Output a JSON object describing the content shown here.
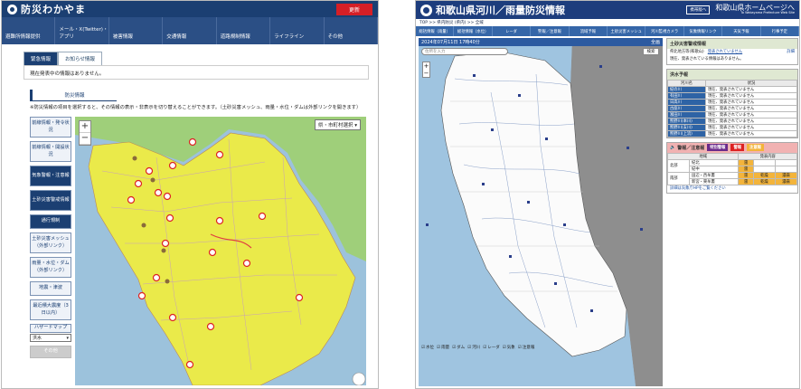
{
  "left": {
    "header": {
      "title": "防災わかやま",
      "red_button": "更新"
    },
    "nav": [
      "避難所情報提供",
      "メール・X(Twitter)・アプリ",
      "被害情報",
      "交通情報",
      "道路規制情報",
      "ライフライン",
      "その他"
    ],
    "tabs": [
      "緊急情報",
      "お知らせ情報"
    ],
    "notice": "現在発表中の情報はありません。",
    "section_title": "防災情報",
    "explanation": "※防災情報の項目を選択すると、その情報の表示・非表示を切り替えることができます。（土砂災害メッシュ、雨量・水位・ダムは外部リンクを開きます）",
    "side_buttons": [
      {
        "label": "前線情報・発令状況",
        "dark": false
      },
      {
        "label": "前線情報・開設状況",
        "dark": false
      },
      {
        "label": "気象警報・注意報",
        "dark": true
      },
      {
        "label": "土砂災害警戒情報",
        "dark": true
      },
      {
        "label": "通行規制",
        "dark": true
      },
      {
        "label": "土砂災害メッシュ（外部リンク）",
        "dark": false
      },
      {
        "label": "雨量・水位・ダム（外部リンク）",
        "dark": false
      },
      {
        "label": "地震・津波",
        "dark": false
      },
      {
        "label": "最近積大震度（3日以内）",
        "dark": false
      }
    ],
    "hazard_label": "ハザードマップ",
    "hazard_select": "洪水",
    "other_button": "その他",
    "map_select": "県・市町村選択",
    "colors": {
      "navy": "#1b3f72",
      "hazard_yellow": "#eaea4a",
      "land_green": "#9fcf7a",
      "sea": "#9cc2dc"
    }
  },
  "right": {
    "header": {
      "title": "和歌山県河川／雨量防災情報",
      "mobile_button": "携帯版へ",
      "home_link": "和歌山県ホームページへ",
      "home_sub": "To Wakayama Prefecture Web Site"
    },
    "breadcrumb": "TOP >> 県内防災 (県内) >> 全域",
    "nav": [
      "総括情報（雨量）",
      "総括情報（水位）",
      "レーダ",
      "警報／注意報",
      "流域予報",
      "土砂災害メッシュ",
      "河川監視カメラ",
      "気象情報リンク",
      "天気予報",
      "行事予定"
    ],
    "map_bar": {
      "time": "2024年07月11日 17時40分",
      "mode": "全画"
    },
    "search": {
      "placeholder": "住所を入力",
      "button": "検索"
    },
    "legend": [
      "水位",
      "雨量",
      "ダム",
      "河川",
      "レーダ",
      "気象",
      "注意報"
    ],
    "panel": {
      "disaster": {
        "title": "土砂災害警戒情報",
        "row_label": "県北地方等(和歌山)",
        "row_status": "発表されていません",
        "row_link": "詳細",
        "note": "現在、発表されている情報はありません。"
      },
      "flood": {
        "title": "洪水予報",
        "headers": [
          "河川名",
          "状況"
        ],
        "rows": [
          [
            "紀の川",
            "現在、発表されていません"
          ],
          [
            "有田川",
            "現在、発表されていません"
          ],
          [
            "日高川",
            "現在、発表されていません"
          ],
          [
            "古座川",
            "現在、発表されていません"
          ],
          [
            "富田川",
            "現在、発表されていません"
          ],
          [
            "熊野川(本川)",
            "現在、発表されていません"
          ],
          [
            "熊野川(支川)",
            "現在、発表されていません"
          ],
          [
            "熊野川(上流)",
            "現在、発表されていません"
          ]
        ]
      },
      "warning": {
        "title": "警報／注意報",
        "badges": [
          "特別警報",
          "警報",
          "注意報"
        ],
        "headers": [
          "地域",
          "発表内容"
        ],
        "rows": [
          {
            "group": "北部",
            "area": "紀北",
            "items": [
              "雷"
            ]
          },
          {
            "group": "",
            "area": "紀中",
            "items": [
              "雷"
            ]
          },
          {
            "group": "南部",
            "area": "田辺・西牟婁",
            "items": [
              "雷",
              "乾燥",
              "濃霧"
            ]
          },
          {
            "group": "",
            "area": "新宮・東牟婁",
            "items": [
              "雷",
              "乾燥",
              "濃霧"
            ]
          }
        ],
        "footnote": "詳細は気象庁HPをご覧ください"
      }
    },
    "colors": {
      "navy": "#1d3d7d",
      "nav_blue": "#3566a8",
      "warning_orange": "#f3b43b"
    }
  }
}
